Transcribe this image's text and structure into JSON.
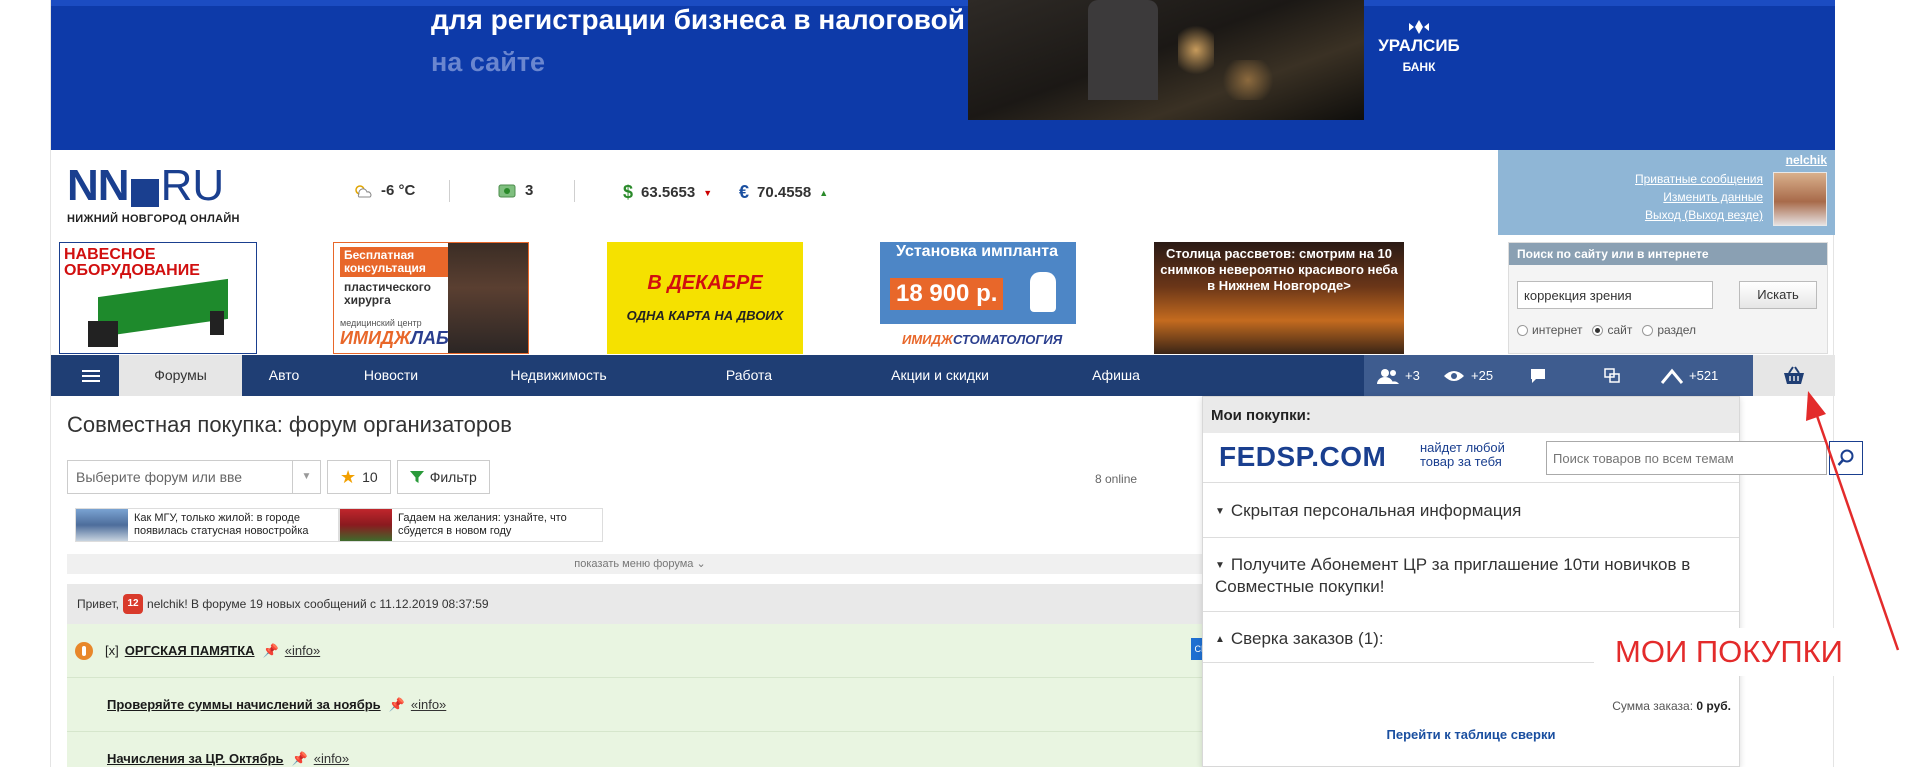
{
  "banner": {
    "line1": "для регистрации бизнеса в налоговой",
    "line2": "на сайте",
    "brand_name": "УРАЛСИБ",
    "brand_sub": "БАНК"
  },
  "header": {
    "logo_main": "NN",
    "logo_ru": "RU",
    "logo_sub": "НИЖНИЙ НОВГОРОД ОНЛАЙН",
    "weather": "-6 °C",
    "traffic": "3",
    "usd": "63.5653",
    "eur": "70.4558",
    "colors": {
      "usd_icon": "#2a8a2a",
      "eur_icon": "#1a4fa0"
    }
  },
  "user": {
    "name": "nelchik",
    "links": [
      "Приватные сообщения",
      "Изменить данные",
      "Выход (Выход везде)"
    ]
  },
  "ads": {
    "ad1": "НАВЕСНОЕ ОБОРУДОВАНИЕ",
    "ad2_text1": "Бесплатная консультация",
    "ad2_text2": "пластического хирурга",
    "ad2_brand_small": "медицинский центр",
    "ad2_brand_a": "ИМИДЖ",
    "ad2_brand_b": "ЛАБ",
    "ad3_title": "В ДЕКАБРЕ",
    "ad3_sub": "ОДНА КАРТА НА ДВОИХ",
    "ad4_title": "Установка импланта",
    "ad4_price": "18 900 р.",
    "ad4_brand_a": "ИМИДЖ",
    "ad4_brand_b": "СТОМАТОЛОГИЯ",
    "ad5": "Столица рассветов: смотрим на 10 снимков невероятно красивого неба в Нижнем Новгороде>"
  },
  "search": {
    "title": "Поиск по сайту или в интернете",
    "value": "коррекция зрения",
    "button": "Искать",
    "options": [
      "интернет",
      "сайт",
      "раздел"
    ],
    "selected": "сайт"
  },
  "nav": {
    "items": [
      "Форумы",
      "Авто",
      "Новости",
      "Недвижимость",
      "Работа",
      "Акции и скидки",
      "Афиша"
    ],
    "friends": "+3",
    "views": "+25",
    "karma": "+521"
  },
  "forum": {
    "title": "Совместная покупка: форум организаторов",
    "select_placeholder": "Выберите форум или вве",
    "fav_count": "10",
    "filter": "Фильтр",
    "online": "8 online",
    "news": [
      "Как МГУ, только жилой: в городе появилась статусная новостройка",
      "Гадаем на желания: узнайте, что сбудется в новом году"
    ],
    "show_menu": "показать меню форума",
    "greet_prefix": "Привет,",
    "greet_badge": "12",
    "greet_text": "nelchik! В форуме 19 новых сообщений с 11.12.2019 08:37:59",
    "topics": [
      {
        "prefix": "[x]",
        "title": "ОРГСКАЯ ПАМЯТКА",
        "info": "«info»",
        "tag": "СП"
      },
      {
        "prefix": "",
        "title": "Проверяйте суммы начислений за ноябрь",
        "info": "«info»",
        "tag": ""
      },
      {
        "prefix": "",
        "title": "Начисления за ЦР. Октябрь",
        "info": "«info»",
        "tag": ""
      }
    ]
  },
  "purchases": {
    "title": "Мои покупки:",
    "logo": "FEDSP.COM",
    "tagline": "найдет любой товар за тебя",
    "search_placeholder": "Поиск товаров по всем темам",
    "sections": [
      "Скрытая персональная информация",
      "Получите Абонемент ЦР за приглашение 10ти новичков в Совместные покупки!",
      "Сверка заказов (1):"
    ],
    "sum_label": "Сумма заказа:",
    "sum_value": "0 руб.",
    "link": "Перейти к таблице сверки"
  },
  "annotation": {
    "label": "МОИ ПОКУПКИ",
    "color": "#e32b2b"
  }
}
